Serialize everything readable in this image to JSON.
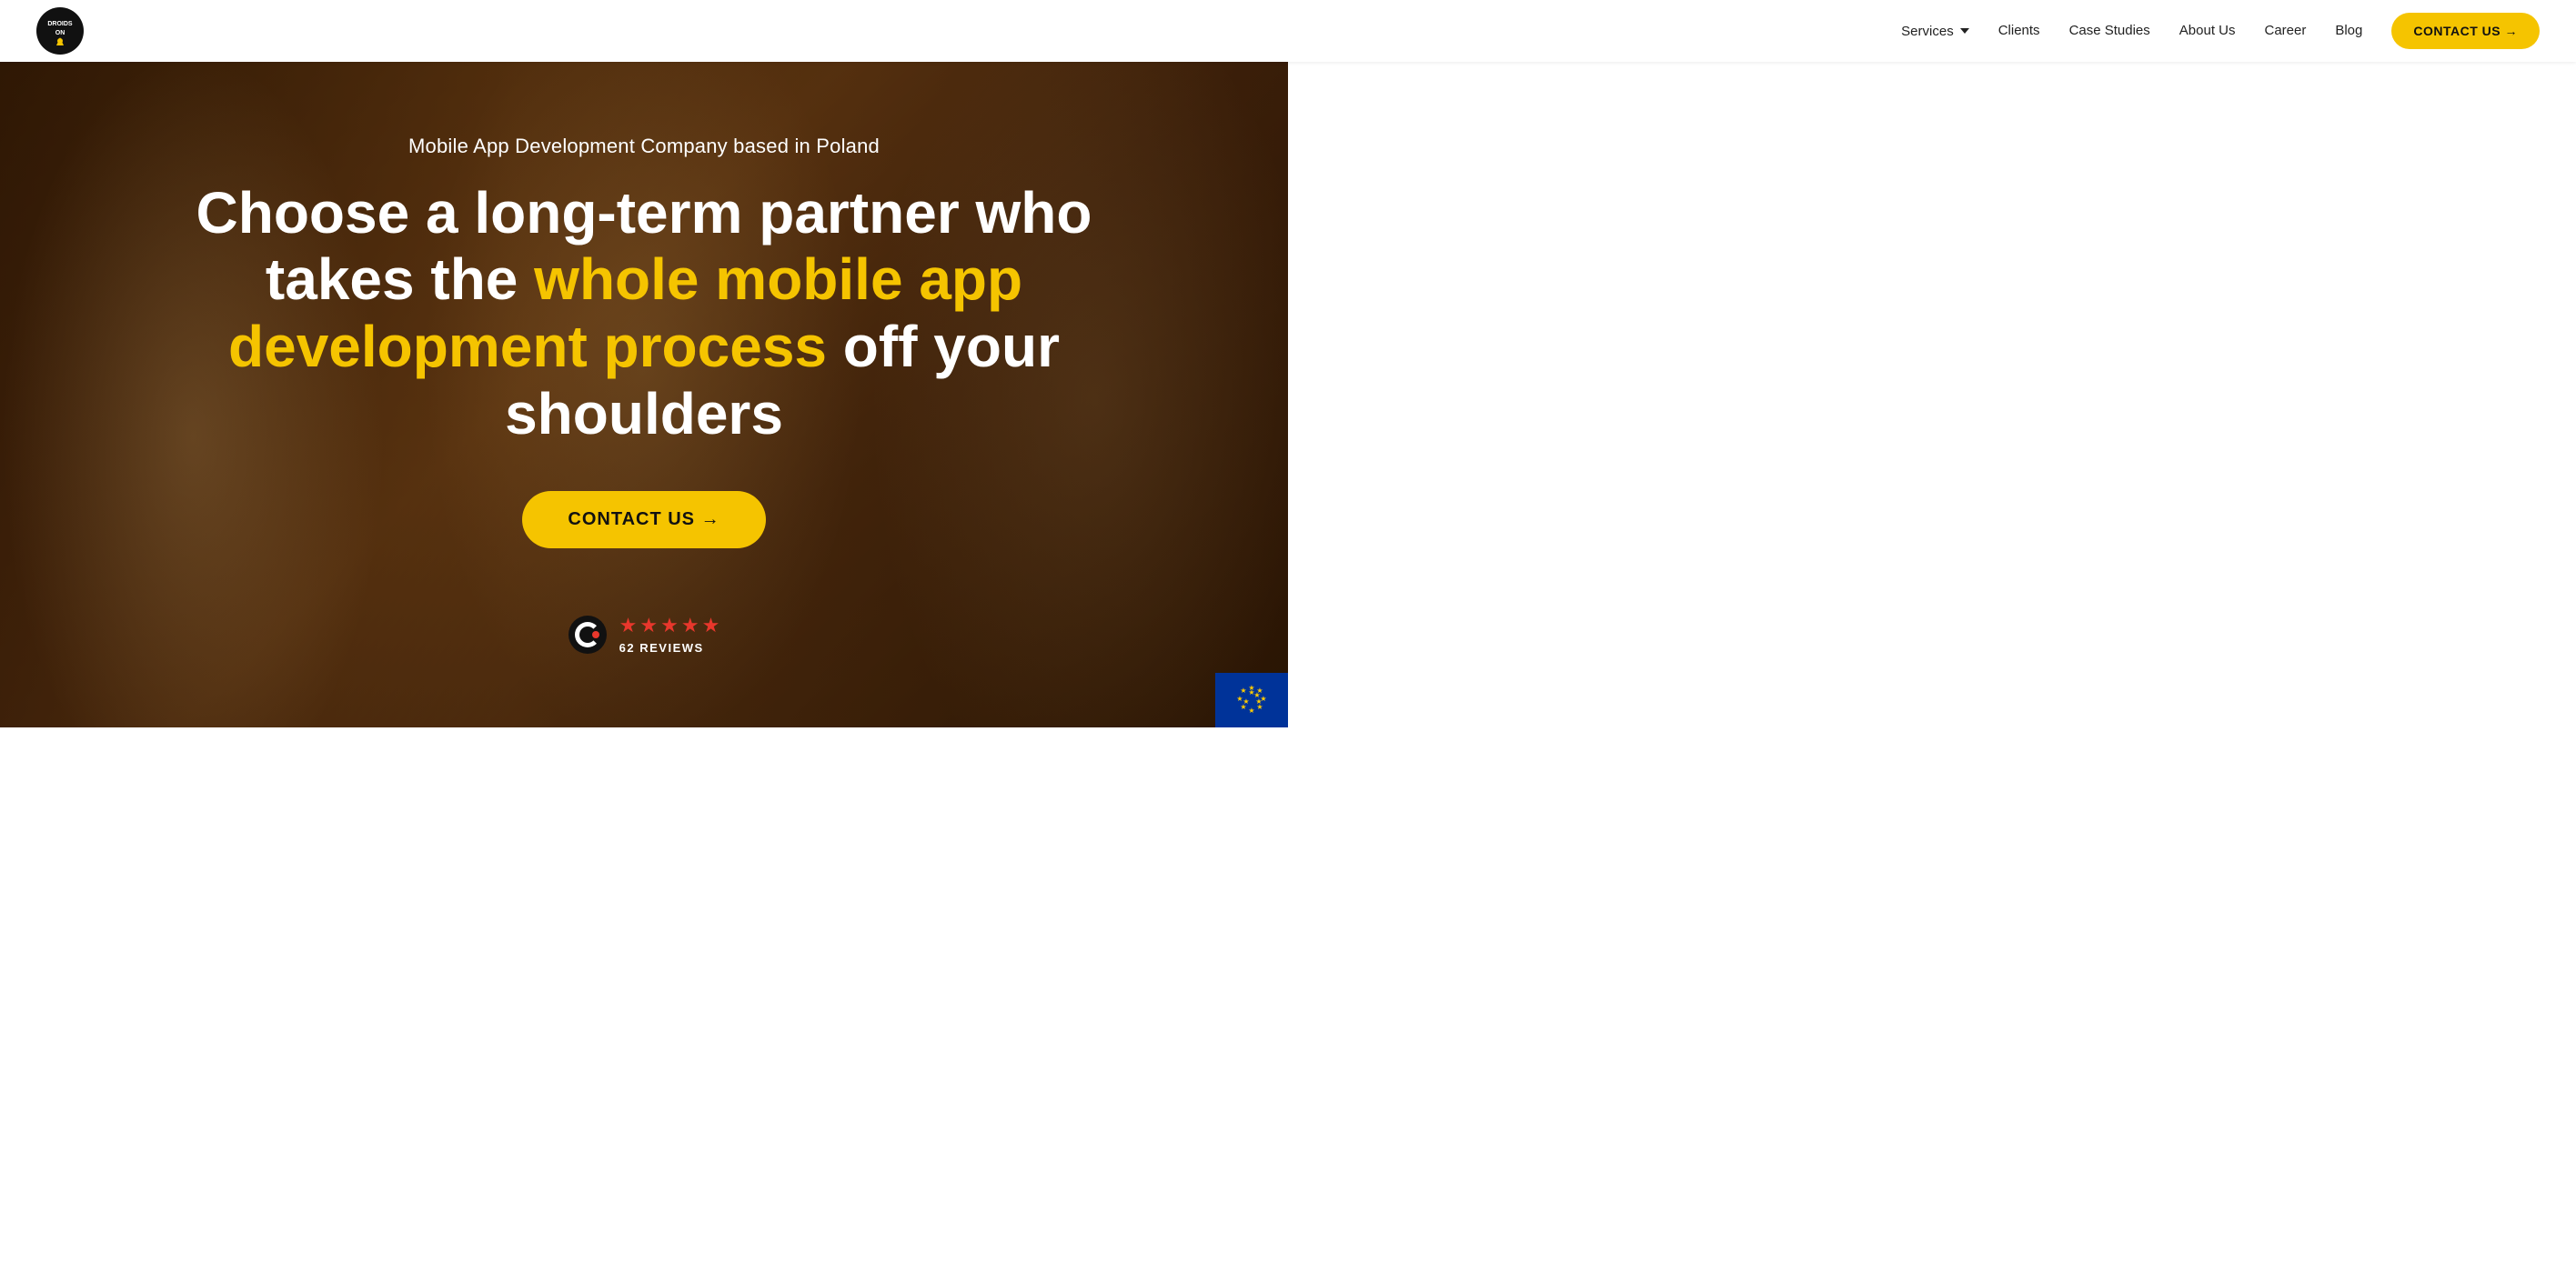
{
  "navbar": {
    "logo_text": "DROIDS ON ROIDS",
    "nav_items": [
      {
        "id": "services",
        "label": "Services",
        "has_dropdown": true
      },
      {
        "id": "clients",
        "label": "Clients",
        "has_dropdown": false
      },
      {
        "id": "case-studies",
        "label": "Case Studies",
        "has_dropdown": false
      },
      {
        "id": "about-us",
        "label": "About Us",
        "has_dropdown": false
      },
      {
        "id": "career",
        "label": "Career",
        "has_dropdown": false
      },
      {
        "id": "blog",
        "label": "Blog",
        "has_dropdown": false
      }
    ],
    "contact_btn": "CONTACT US →"
  },
  "hero": {
    "subtitle": "Mobile App Development Company based in Poland",
    "title_part1": "Choose a long-term partner who takes the ",
    "title_highlight": "whole mobile app development process",
    "title_part2": " off your shoulders",
    "contact_btn": "CONTACT US →",
    "reviews": {
      "star_count": 5,
      "review_count": "62 REVIEWS"
    }
  },
  "colors": {
    "accent": "#f5c400",
    "star_color": "#e8372c",
    "nav_bg": "#ffffff",
    "hero_text": "#ffffff"
  }
}
